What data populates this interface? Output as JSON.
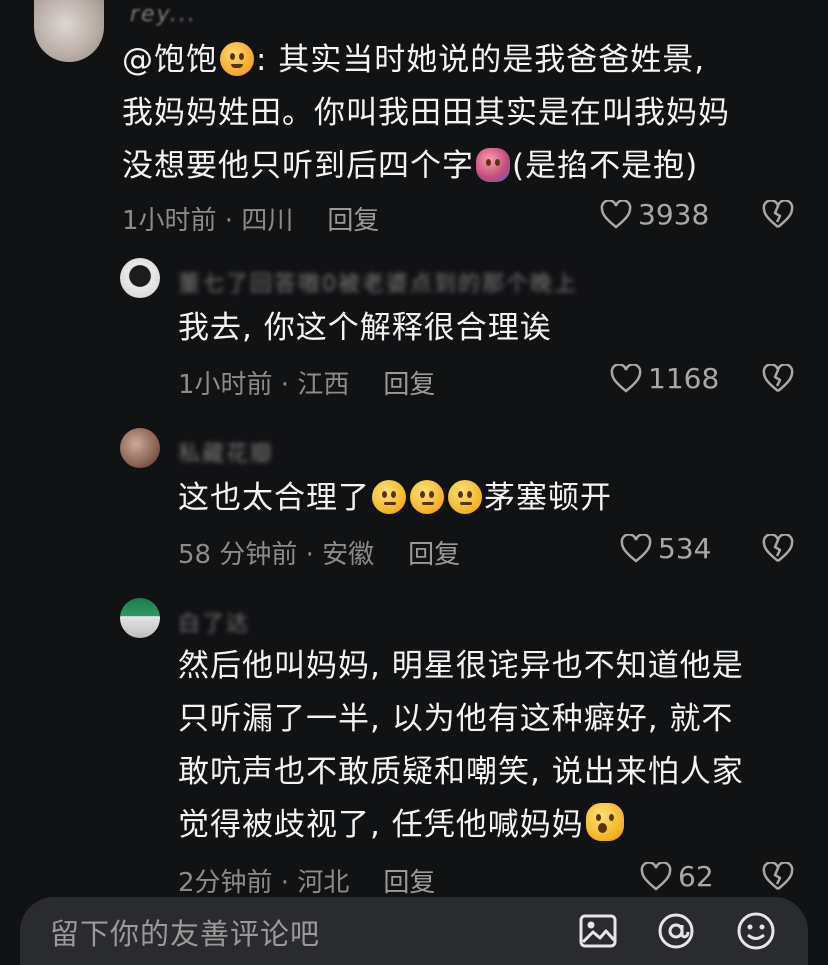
{
  "comments": {
    "c1": {
      "username": "rey...",
      "lines": [
        "@饱饱",
        ": 其实当时她说的是我爸爸姓景,",
        "我妈妈姓田。你叫我田田其实是在叫我妈妈",
        "没想要他只听到后四个字",
        "(是掐不是抱)"
      ],
      "time_location": "1小时前 · 四川",
      "reply_label": "回复",
      "likes": "3938"
    },
    "c2": {
      "username": "董七了回答嗷0被老婆点到的那个晚上",
      "lines": [
        "我去, 你这个解释很合理诶"
      ],
      "time_location": "1小时前 · 江西",
      "reply_label": "回复",
      "likes": "1168"
    },
    "c3": {
      "username": "私藏花瓣",
      "lines": [
        "这也太合理了",
        "茅塞顿开"
      ],
      "time_location": "58 分钟前 · 安徽",
      "reply_label": "回复",
      "likes": "534"
    },
    "c4": {
      "username": "白了达",
      "lines": [
        "然后他叫妈妈, 明星很诧异也不知道他是",
        "只听漏了一半, 以为他有这种癖好, 就不",
        "敢吭声也不敢质疑和嘲笑, 说出来怕人家",
        "觉得被歧视了, 任凭他喊妈妈"
      ],
      "time_location": "2分钟前 · 河北",
      "reply_label": "回复",
      "likes": "62"
    }
  },
  "input": {
    "placeholder": "留下你的友善评论吧"
  },
  "icons": {
    "like": "heart-outline-icon",
    "dislike": "broken-heart-icon",
    "image": "image-icon",
    "mention": "at-sign-icon",
    "emoji": "emoji-icon"
  },
  "colors": {
    "background": "#111214",
    "muted_text": "#8b8b8b",
    "input_bg": "#2a2b2e"
  }
}
